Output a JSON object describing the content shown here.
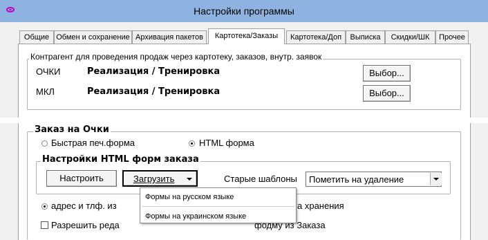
{
  "window": {
    "title": "Настройки программы",
    "icon": "eye-icon"
  },
  "tabs": [
    {
      "label": "Общие",
      "active": false
    },
    {
      "label": "Обмен и сохранение",
      "active": false
    },
    {
      "label": "Архивация пакетов",
      "active": false
    },
    {
      "label": "Картотека/Заказы",
      "active": true
    },
    {
      "label": "Картотека/Доп",
      "active": false
    },
    {
      "label": "Выписка",
      "active": false
    },
    {
      "label": "Скидки/ШК",
      "active": false
    },
    {
      "label": "Прочее",
      "active": false
    }
  ],
  "counterparty": {
    "legend": "Контрагент для проведения продаж через картотеку, заказов, внутр. заявок",
    "rows": [
      {
        "code": "ОЧКИ",
        "value": "Реализация / Тренировка",
        "button": "Выбор..."
      },
      {
        "code": "МКЛ",
        "value": "Реализация / Тренировка",
        "button": "Выбор..."
      }
    ]
  },
  "order": {
    "legend": "Заказ на Очки",
    "radio_quick": "Быстрая печ.форма",
    "radio_html": "HTML форма",
    "selected": "html",
    "html_settings": {
      "legend": "Настройки HTML форм заказа",
      "configure_button": "Настроить",
      "load_button": "Загрузить",
      "old_templates_label": "Старые шаблоны",
      "old_templates_value": "Пометить на удаление"
    },
    "address_radio_prefix": "адрес и тлф. из",
    "address_radio_suffix": "а хранения",
    "allow_edit_prefix": "Разрешить реда",
    "allow_edit_suffix": "фодму из Заказа"
  },
  "load_menu": {
    "items": [
      "Формы на русском языке",
      "Формы на украинском языке"
    ]
  }
}
